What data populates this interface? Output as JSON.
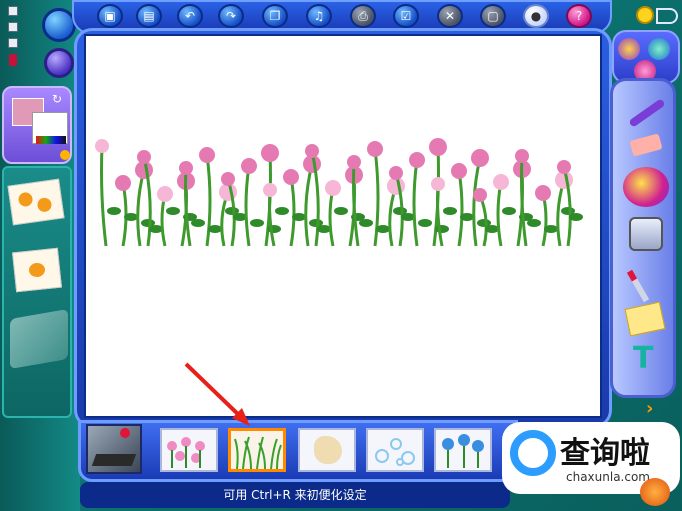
{
  "toolbar": {
    "buttons": [
      "file-new",
      "open",
      "undo",
      "redo",
      "copy",
      "music",
      "print",
      "check",
      "close-doc",
      "save",
      "tip",
      "help"
    ],
    "help_label": "?"
  },
  "status": {
    "text": "可用 Ctrl+R 来初便化设定"
  },
  "thumbnails": [
    {
      "name": "pink-flowers-stamp",
      "selected": false
    },
    {
      "name": "grass-stamp",
      "selected": true
    },
    {
      "name": "beige-shape-stamp",
      "selected": false
    },
    {
      "name": "bubbles-stamp",
      "selected": false
    },
    {
      "name": "blue-flowers-stamp",
      "selected": false
    }
  ],
  "watermark": {
    "title": "查询啦",
    "url": "chaxunla.com"
  },
  "colors": {
    "accent": "#2a62e6",
    "selected_thumb": "#ff8a00",
    "canvas": "#ffffff"
  }
}
